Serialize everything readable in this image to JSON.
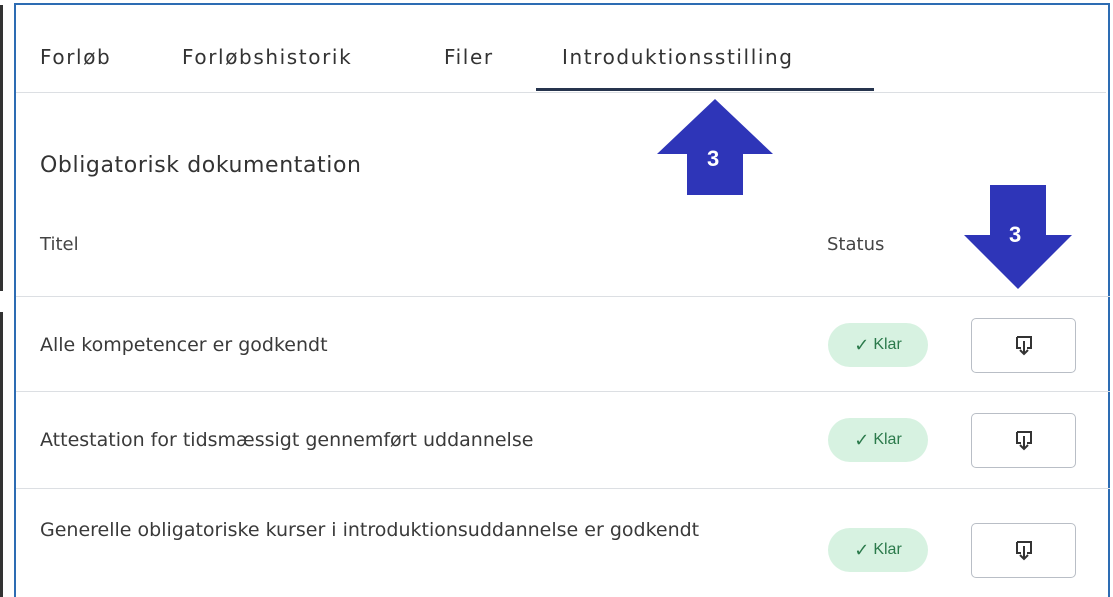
{
  "tabs": [
    {
      "label": "Forløb"
    },
    {
      "label": "Forløbshistorik"
    },
    {
      "label": "Filer"
    },
    {
      "label": "Introduktionsstilling",
      "active": true
    }
  ],
  "section": {
    "title": "Obligatorisk dokumentation"
  },
  "table": {
    "columns": {
      "title": "Titel",
      "status": "Status"
    },
    "rows": [
      {
        "title": "Alle kompetencer er godkendt",
        "status": "Klar"
      },
      {
        "title": "Attestation for tidsmæssigt gennemført uddannelse",
        "status": "Klar"
      },
      {
        "title": "Generelle obligatoriske kurser i introduktionsuddannelse er godkendt",
        "status": "Klar"
      }
    ]
  },
  "annotations": {
    "arrow_up_number": "3",
    "arrow_down_number": "3"
  },
  "icons": {
    "status": "check-icon",
    "download": "download-icon",
    "annotation": "arrow-icon"
  },
  "colors": {
    "tab_underline": "#26344d",
    "badge_bg": "#d7f2e1",
    "badge_text": "#2b7a4b",
    "annotation_arrow": "#2e35b8",
    "frame": "#2d6cb3"
  }
}
